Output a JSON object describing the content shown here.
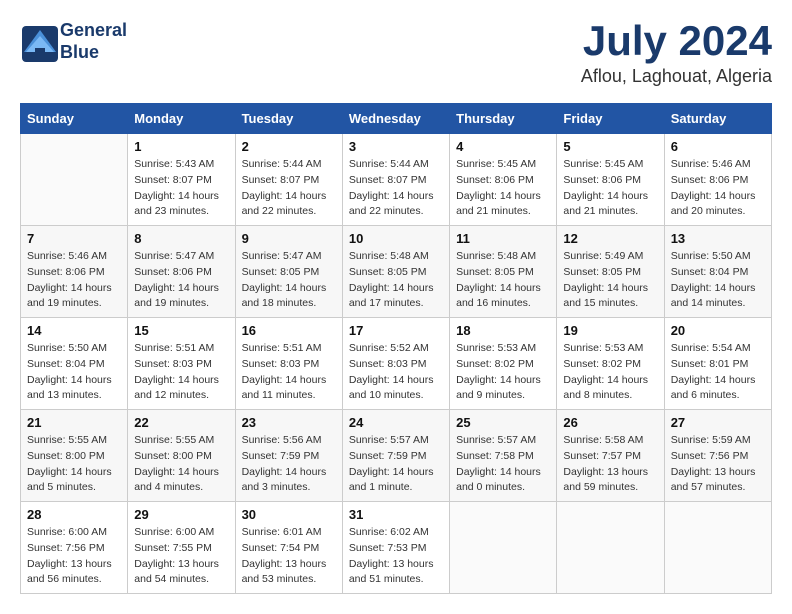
{
  "header": {
    "logo_line1": "General",
    "logo_line2": "Blue",
    "month": "July 2024",
    "location": "Aflou, Laghouat, Algeria"
  },
  "days_of_week": [
    "Sunday",
    "Monday",
    "Tuesday",
    "Wednesday",
    "Thursday",
    "Friday",
    "Saturday"
  ],
  "weeks": [
    [
      {
        "day": "",
        "info": ""
      },
      {
        "day": "1",
        "info": "Sunrise: 5:43 AM\nSunset: 8:07 PM\nDaylight: 14 hours\nand 23 minutes."
      },
      {
        "day": "2",
        "info": "Sunrise: 5:44 AM\nSunset: 8:07 PM\nDaylight: 14 hours\nand 22 minutes."
      },
      {
        "day": "3",
        "info": "Sunrise: 5:44 AM\nSunset: 8:07 PM\nDaylight: 14 hours\nand 22 minutes."
      },
      {
        "day": "4",
        "info": "Sunrise: 5:45 AM\nSunset: 8:06 PM\nDaylight: 14 hours\nand 21 minutes."
      },
      {
        "day": "5",
        "info": "Sunrise: 5:45 AM\nSunset: 8:06 PM\nDaylight: 14 hours\nand 21 minutes."
      },
      {
        "day": "6",
        "info": "Sunrise: 5:46 AM\nSunset: 8:06 PM\nDaylight: 14 hours\nand 20 minutes."
      }
    ],
    [
      {
        "day": "7",
        "info": "Sunrise: 5:46 AM\nSunset: 8:06 PM\nDaylight: 14 hours\nand 19 minutes."
      },
      {
        "day": "8",
        "info": "Sunrise: 5:47 AM\nSunset: 8:06 PM\nDaylight: 14 hours\nand 19 minutes."
      },
      {
        "day": "9",
        "info": "Sunrise: 5:47 AM\nSunset: 8:05 PM\nDaylight: 14 hours\nand 18 minutes."
      },
      {
        "day": "10",
        "info": "Sunrise: 5:48 AM\nSunset: 8:05 PM\nDaylight: 14 hours\nand 17 minutes."
      },
      {
        "day": "11",
        "info": "Sunrise: 5:48 AM\nSunset: 8:05 PM\nDaylight: 14 hours\nand 16 minutes."
      },
      {
        "day": "12",
        "info": "Sunrise: 5:49 AM\nSunset: 8:05 PM\nDaylight: 14 hours\nand 15 minutes."
      },
      {
        "day": "13",
        "info": "Sunrise: 5:50 AM\nSunset: 8:04 PM\nDaylight: 14 hours\nand 14 minutes."
      }
    ],
    [
      {
        "day": "14",
        "info": "Sunrise: 5:50 AM\nSunset: 8:04 PM\nDaylight: 14 hours\nand 13 minutes."
      },
      {
        "day": "15",
        "info": "Sunrise: 5:51 AM\nSunset: 8:03 PM\nDaylight: 14 hours\nand 12 minutes."
      },
      {
        "day": "16",
        "info": "Sunrise: 5:51 AM\nSunset: 8:03 PM\nDaylight: 14 hours\nand 11 minutes."
      },
      {
        "day": "17",
        "info": "Sunrise: 5:52 AM\nSunset: 8:03 PM\nDaylight: 14 hours\nand 10 minutes."
      },
      {
        "day": "18",
        "info": "Sunrise: 5:53 AM\nSunset: 8:02 PM\nDaylight: 14 hours\nand 9 minutes."
      },
      {
        "day": "19",
        "info": "Sunrise: 5:53 AM\nSunset: 8:02 PM\nDaylight: 14 hours\nand 8 minutes."
      },
      {
        "day": "20",
        "info": "Sunrise: 5:54 AM\nSunset: 8:01 PM\nDaylight: 14 hours\nand 6 minutes."
      }
    ],
    [
      {
        "day": "21",
        "info": "Sunrise: 5:55 AM\nSunset: 8:00 PM\nDaylight: 14 hours\nand 5 minutes."
      },
      {
        "day": "22",
        "info": "Sunrise: 5:55 AM\nSunset: 8:00 PM\nDaylight: 14 hours\nand 4 minutes."
      },
      {
        "day": "23",
        "info": "Sunrise: 5:56 AM\nSunset: 7:59 PM\nDaylight: 14 hours\nand 3 minutes."
      },
      {
        "day": "24",
        "info": "Sunrise: 5:57 AM\nSunset: 7:59 PM\nDaylight: 14 hours\nand 1 minute."
      },
      {
        "day": "25",
        "info": "Sunrise: 5:57 AM\nSunset: 7:58 PM\nDaylight: 14 hours\nand 0 minutes."
      },
      {
        "day": "26",
        "info": "Sunrise: 5:58 AM\nSunset: 7:57 PM\nDaylight: 13 hours\nand 59 minutes."
      },
      {
        "day": "27",
        "info": "Sunrise: 5:59 AM\nSunset: 7:56 PM\nDaylight: 13 hours\nand 57 minutes."
      }
    ],
    [
      {
        "day": "28",
        "info": "Sunrise: 6:00 AM\nSunset: 7:56 PM\nDaylight: 13 hours\nand 56 minutes."
      },
      {
        "day": "29",
        "info": "Sunrise: 6:00 AM\nSunset: 7:55 PM\nDaylight: 13 hours\nand 54 minutes."
      },
      {
        "day": "30",
        "info": "Sunrise: 6:01 AM\nSunset: 7:54 PM\nDaylight: 13 hours\nand 53 minutes."
      },
      {
        "day": "31",
        "info": "Sunrise: 6:02 AM\nSunset: 7:53 PM\nDaylight: 13 hours\nand 51 minutes."
      },
      {
        "day": "",
        "info": ""
      },
      {
        "day": "",
        "info": ""
      },
      {
        "day": "",
        "info": ""
      }
    ]
  ]
}
